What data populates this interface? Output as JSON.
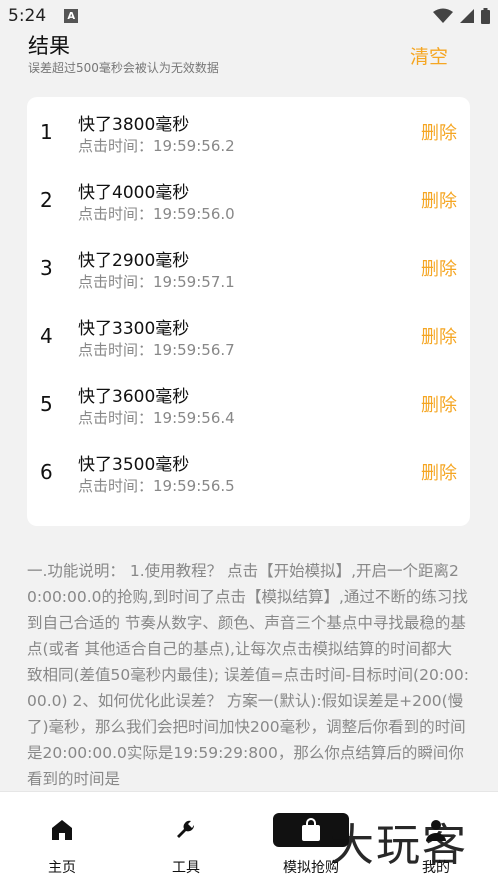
{
  "status_bar": {
    "time": "5:24",
    "notification_icon": "A"
  },
  "header": {
    "title": "结果",
    "subtitle": "误差超过500毫秒会被认为无效数据",
    "clear_label": "清空"
  },
  "results": [
    {
      "index": "1",
      "title": "快了3800毫秒",
      "time": "点击时间：19:59:56.2",
      "delete_label": "删除"
    },
    {
      "index": "2",
      "title": "快了4000毫秒",
      "time": "点击时间：19:59:56.0",
      "delete_label": "删除"
    },
    {
      "index": "3",
      "title": "快了2900毫秒",
      "time": "点击时间：19:59:57.1",
      "delete_label": "删除"
    },
    {
      "index": "4",
      "title": "快了3300毫秒",
      "time": "点击时间：19:59:56.7",
      "delete_label": "删除"
    },
    {
      "index": "5",
      "title": "快了3600毫秒",
      "time": "点击时间：19:59:56.4",
      "delete_label": "删除"
    },
    {
      "index": "6",
      "title": "快了3500毫秒",
      "time": "点击时间：19:59:56.5",
      "delete_label": "删除"
    }
  ],
  "description": "一.功能说明： 1.使用教程？ 点击【开始模拟】,开启一个距离20:00:00.0的抢购,到时间了点击【模拟结算】,通过不断的练习找到自己合适的 节奏从数字、颜色、声音三个基点中寻找最稳的基点(或者 其他适合自己的基点),让每次点击模拟结算的时间都大 致相同(差值50毫秒内最佳); 误差值=点击时间-目标时间(20:00:00.0) 2、如何优化此误差？ 方案一(默认):假如误差是+200(慢了)毫秒，那么我们会把时间加快200毫秒，调整后你看到的时间是20:00:00.0实际是19:59:29:800，那么你点结算后的瞬间你看到的时间是",
  "bottom_nav": [
    {
      "label": "主页",
      "icon": "home-icon"
    },
    {
      "label": "工具",
      "icon": "wrench-icon"
    },
    {
      "label": "模拟抢购",
      "icon": "shopping-bag-icon",
      "active": true
    },
    {
      "label": "我的",
      "icon": "person-icon"
    }
  ],
  "watermark": "大玩客",
  "colors": {
    "accent": "#f5a623",
    "background": "#f2f2f2",
    "card": "#ffffff"
  }
}
